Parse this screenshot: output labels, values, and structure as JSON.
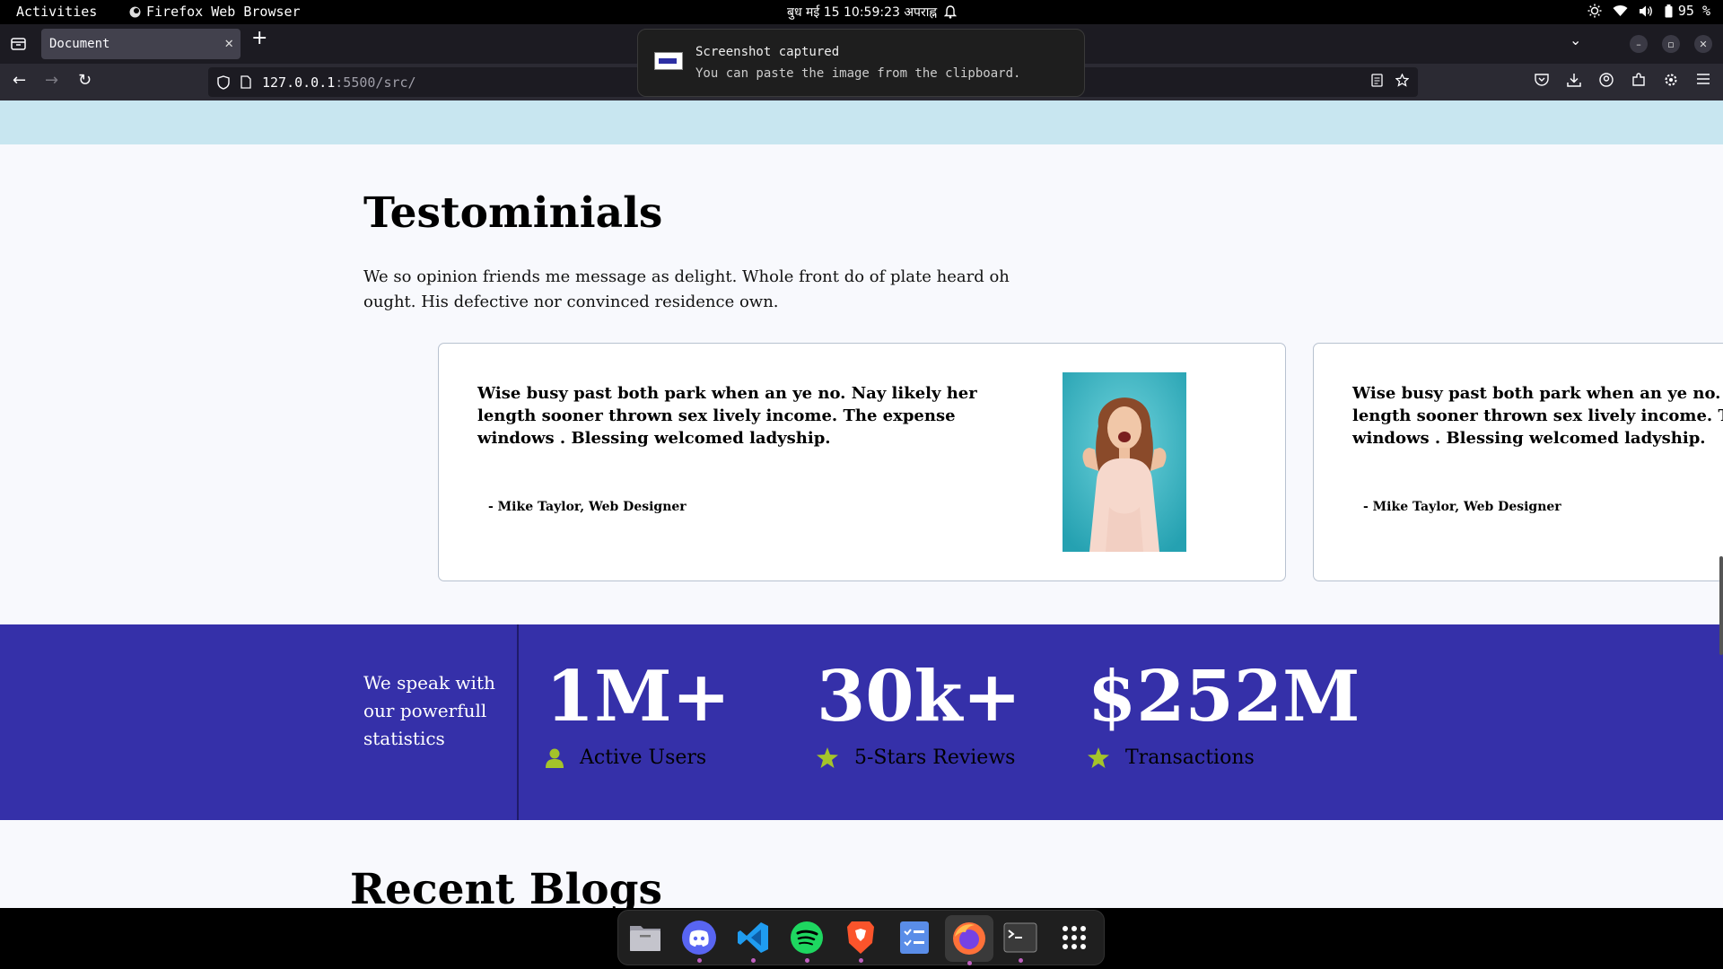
{
  "topbar": {
    "activities": "Activities",
    "app_name": "Firefox Web Browser",
    "datetime": "बुध मई 15  10:59:23 अपराह्न",
    "battery": "95 %"
  },
  "browser": {
    "tab_title": "Document",
    "url_host": "127.0.0.1",
    "url_path": ":5500/src/"
  },
  "notification": {
    "title": "Screenshot captured",
    "body": "You can paste the image from the clipboard."
  },
  "testimonials": {
    "heading": "Testominials",
    "intro": "We so opinion friends me message as delight. Whole front do of plate heard oh ought. His defective nor convinced residence own.",
    "cards": [
      {
        "quote": "Wise busy past both park when an ye no. Nay likely her length sooner thrown sex lively income. The expense windows . Blessing welcomed ladyship.",
        "author": "- Mike Taylor, Web Designer"
      },
      {
        "quote": "Wise busy past both park when an ye no. Nay likely her length sooner thrown sex lively income. The expense windows . Blessing welcomed ladyship.",
        "author": "- Mike Taylor, Web Designer"
      }
    ]
  },
  "stats": {
    "lead": "We speak with our powerfull statistics",
    "items": [
      {
        "value": "1M+",
        "label": "Active Users",
        "icon": "user-icon"
      },
      {
        "value": "30k+",
        "label": "5-Stars Reviews",
        "icon": "star-icon"
      },
      {
        "value": "$252M",
        "label": "Transactions",
        "icon": "star-icon"
      }
    ],
    "accent_color": "#a4c42a",
    "band_color": "#3530a9"
  },
  "blogs": {
    "heading": "Recent Blogs"
  },
  "dock": {
    "apps": [
      "files-icon",
      "discord-icon",
      "vscode-icon",
      "spotify-icon",
      "brave-icon",
      "tasks-icon",
      "firefox-icon",
      "terminal-icon",
      "app-grid-icon"
    ]
  }
}
